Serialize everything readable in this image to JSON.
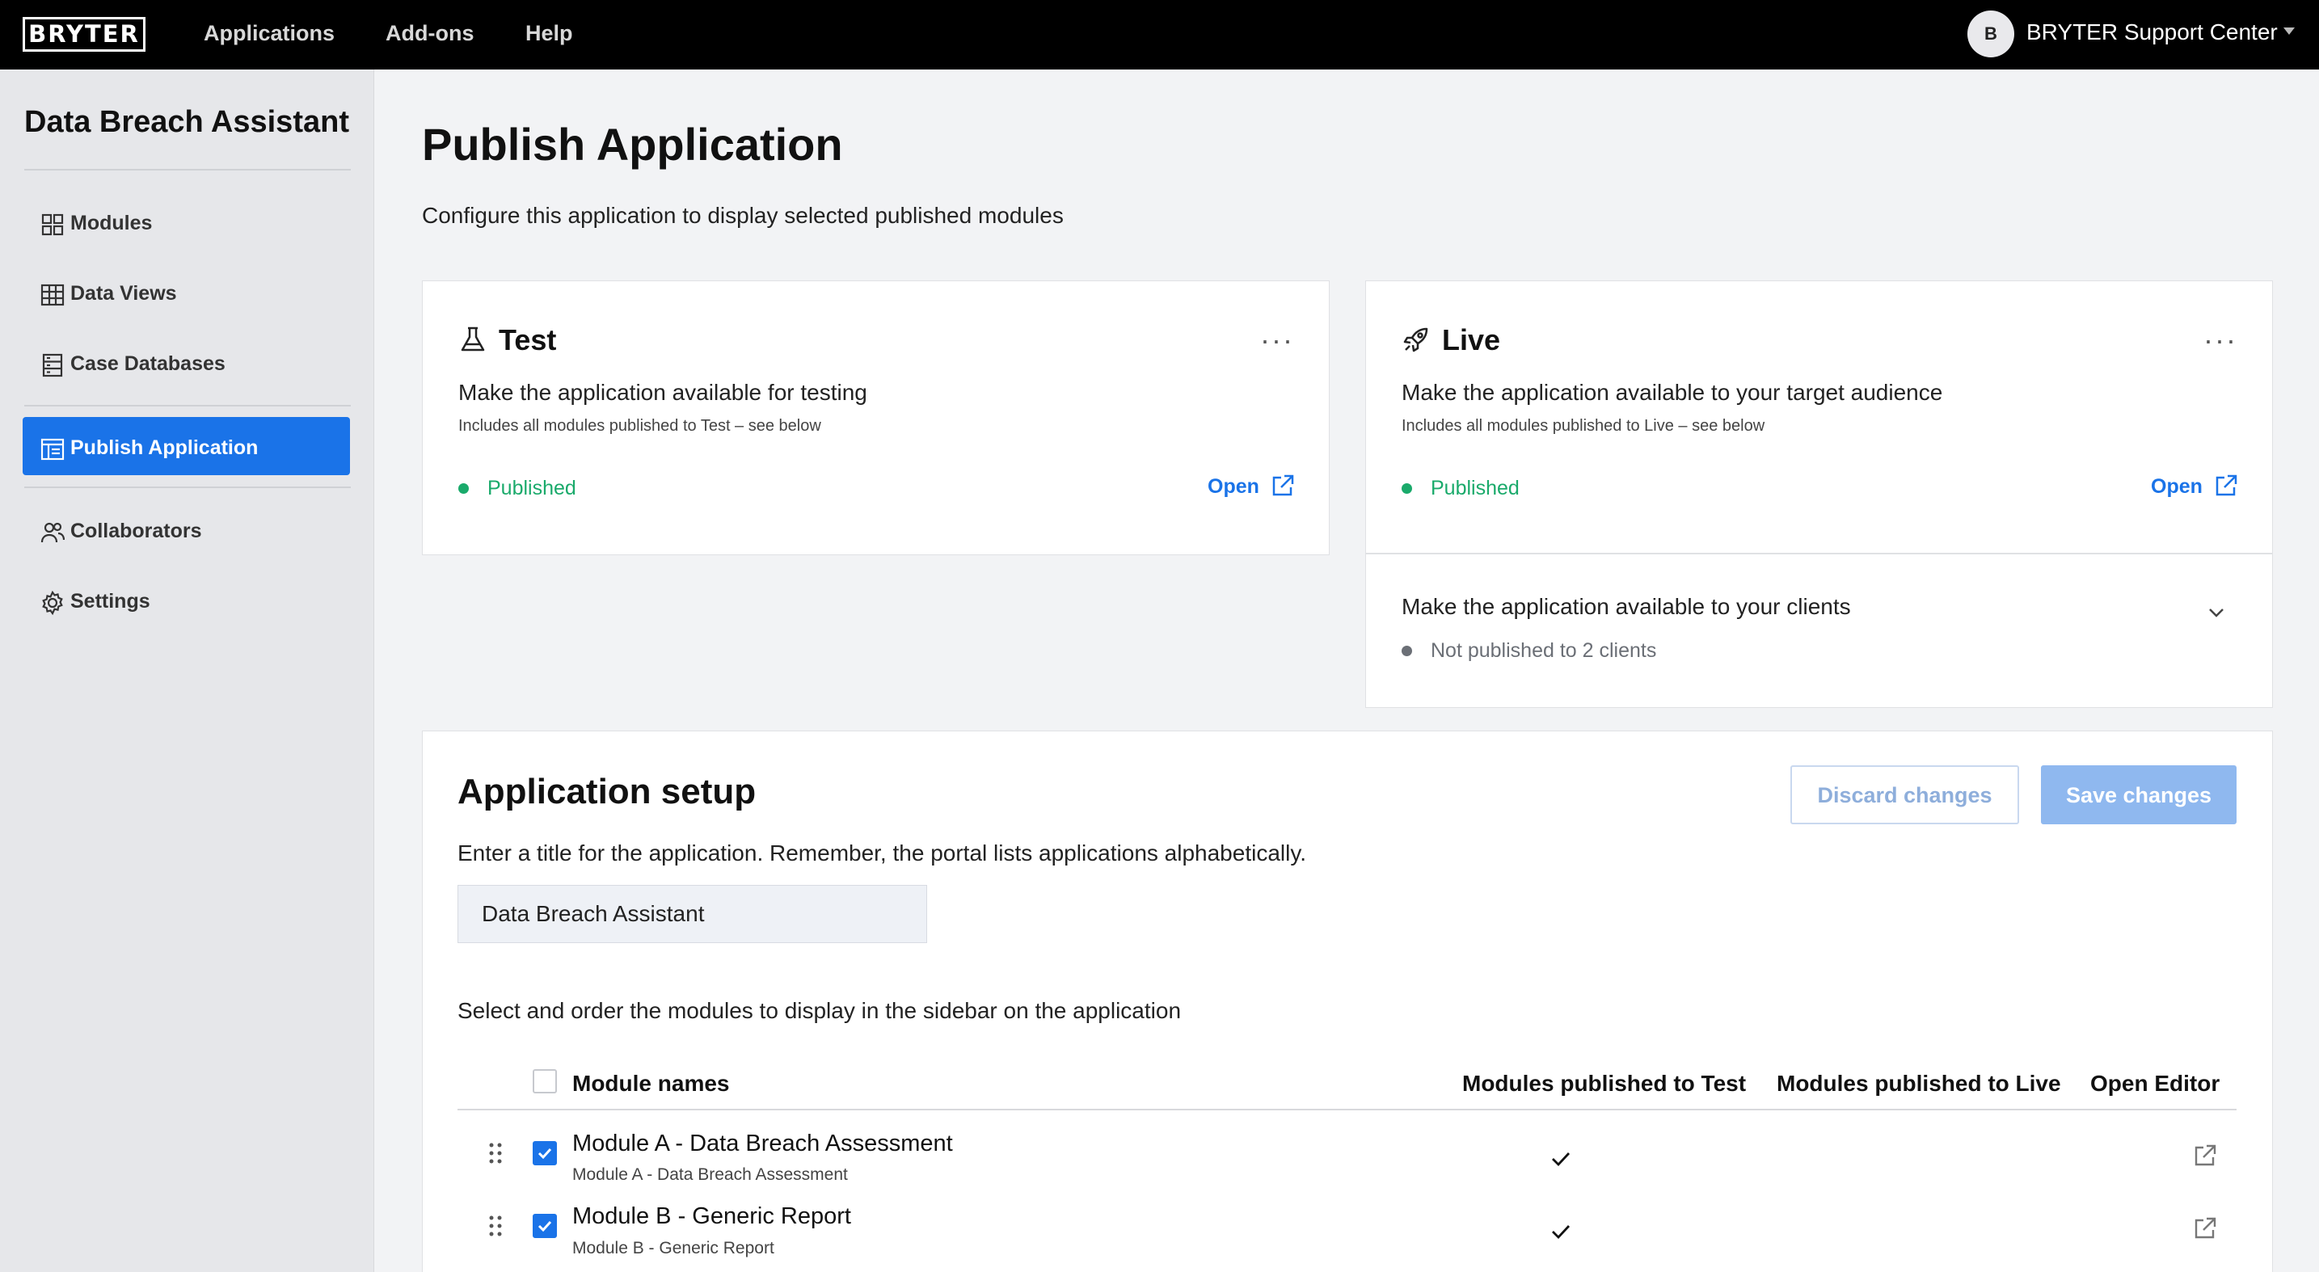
{
  "topbar": {
    "logo": "BRYTER",
    "nav": [
      "Applications",
      "Add-ons",
      "Help"
    ],
    "avatar_initial": "B",
    "support": "BRYTER Support Center"
  },
  "sidebar": {
    "app_title": "Data Breach Assistant",
    "items": [
      {
        "label": "Modules",
        "icon": "modules-icon"
      },
      {
        "label": "Data Views",
        "icon": "table-icon"
      },
      {
        "label": "Case Databases",
        "icon": "database-icon"
      },
      {
        "label": "Publish Application",
        "icon": "publish-icon",
        "active": true
      },
      {
        "label": "Collaborators",
        "icon": "people-icon"
      },
      {
        "label": "Settings",
        "icon": "gear-icon"
      }
    ]
  },
  "main": {
    "title": "Publish Application",
    "subtitle": "Configure this application to display selected published modules"
  },
  "test_card": {
    "title": "Test",
    "description": "Make the application available for testing",
    "note": "Includes all modules published to Test – see below",
    "status": "Published",
    "open_label": "Open"
  },
  "live_card": {
    "title": "Live",
    "description": "Make the application available to your target audience",
    "note": "Includes all modules published to Live – see below",
    "status": "Published",
    "open_label": "Open",
    "clients_title": "Make the application available to your clients",
    "clients_status": "Not published to 2 clients"
  },
  "setup": {
    "title": "Application setup",
    "discard_label": "Discard changes",
    "save_label": "Save changes",
    "title_prompt": "Enter a title for the application. Remember, the portal lists applications alphabetically.",
    "title_value": "Data Breach Assistant",
    "modules_prompt": "Select and order the modules to display in the sidebar on the application",
    "columns": [
      "Module names",
      "Modules published to Test",
      "Modules published to Live",
      "Open Editor"
    ],
    "modules": [
      {
        "name": "Module A - Data Breach Assessment",
        "sub": "Module A - Data Breach Assessment",
        "selected": true,
        "test": true,
        "live": false
      },
      {
        "name": "Module B - Generic Report",
        "sub": "Module B - Generic Report",
        "selected": true,
        "test": true,
        "live": false
      }
    ]
  },
  "colors": {
    "accent": "#1a73e8",
    "published": "#1aaa6b",
    "muted": "#6b6f76",
    "topbar": "#000000"
  }
}
